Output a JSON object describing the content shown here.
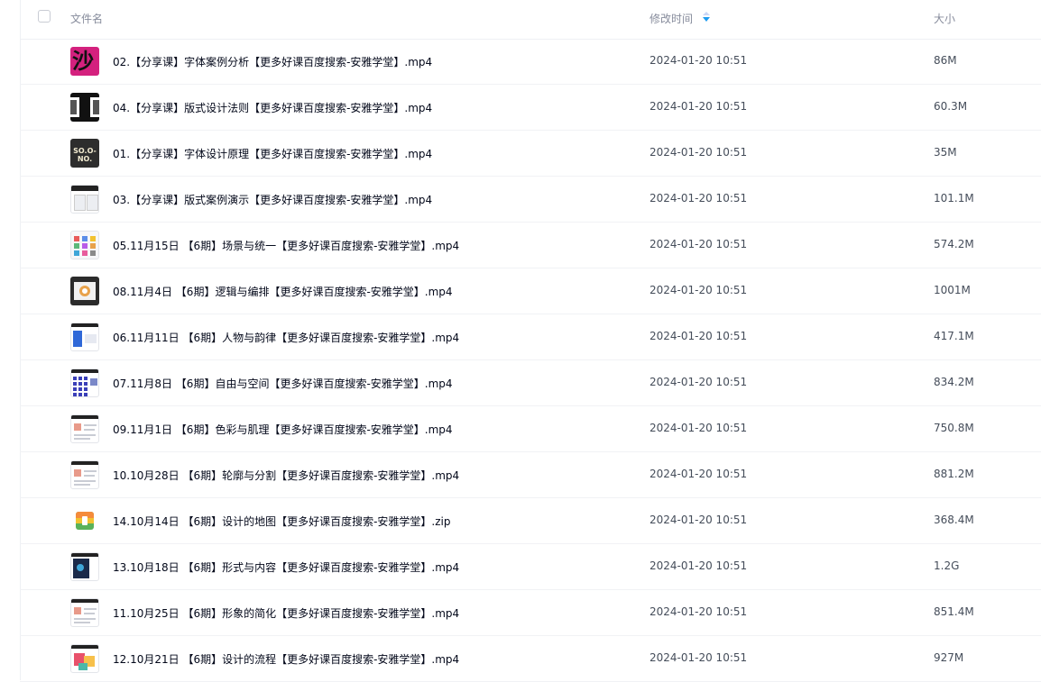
{
  "header": {
    "name_label": "文件名",
    "time_label": "修改时间",
    "size_label": "大小",
    "sort_icon": "sort-icon"
  },
  "files": [
    {
      "name": "02.【分享课】字体案例分析【更多好课百度搜索-安雅学堂】.mp4",
      "time": "2024-01-20 10:51",
      "size": "86M",
      "thumb": "pink",
      "thumb_text": "沙"
    },
    {
      "name": "04.【分享课】版式设计法则【更多好课百度搜索-安雅学堂】.mp4",
      "time": "2024-01-20 10:51",
      "size": "60.3M",
      "thumb": "bw"
    },
    {
      "name": "01.【分享课】字体设计原理【更多好课百度搜索-安雅学堂】.mp4",
      "time": "2024-01-20 10:51",
      "size": "35M",
      "thumb": "dark",
      "thumb_text": "SO.O-NO."
    },
    {
      "name": "03.【分享课】版式案例演示【更多好课百度搜索-安雅学堂】.mp4",
      "time": "2024-01-20 10:51",
      "size": "101.1M",
      "thumb": "doc"
    },
    {
      "name": "05.11月15日 【6期】场景与统一【更多好课百度搜索-安雅学堂】.mp4",
      "time": "2024-01-20 10:51",
      "size": "574.2M",
      "thumb": "grid"
    },
    {
      "name": "08.11月4日 【6期】逻辑与编排【更多好课百度搜索-安雅学堂】.mp4",
      "time": "2024-01-20 10:51",
      "size": "1001M",
      "thumb": "frame"
    },
    {
      "name": "06.11月11日 【6期】人物与韵律【更多好课百度搜索-安雅学堂】.mp4",
      "time": "2024-01-20 10:51",
      "size": "417.1M",
      "thumb": "blue"
    },
    {
      "name": "07.11月8日 【6期】自由与空间【更多好课百度搜索-安雅学堂】.mp4",
      "time": "2024-01-20 10:51",
      "size": "834.2M",
      "thumb": "tiles"
    },
    {
      "name": "09.11月1日 【6期】色彩与肌理【更多好课百度搜索-安雅学堂】.mp4",
      "time": "2024-01-20 10:51",
      "size": "750.8M",
      "thumb": "light"
    },
    {
      "name": "10.10月28日 【6期】轮廓与分割【更多好课百度搜索-安雅学堂】.mp4",
      "time": "2024-01-20 10:51",
      "size": "881.2M",
      "thumb": "light"
    },
    {
      "name": "14.10月14日 【6期】设计的地图【更多好课百度搜索-安雅学堂】.zip",
      "time": "2024-01-20 10:51",
      "size": "368.4M",
      "thumb": "zip"
    },
    {
      "name": "13.10月18日 【6期】形式与内容【更多好课百度搜索-安雅学堂】.mp4",
      "time": "2024-01-20 10:51",
      "size": "1.2G",
      "thumb": "navy"
    },
    {
      "name": "11.10月25日 【6期】形象的简化【更多好课百度搜索-安雅学堂】.mp4",
      "time": "2024-01-20 10:51",
      "size": "851.4M",
      "thumb": "light"
    },
    {
      "name": "12.10月21日 【6期】设计的流程【更多好课百度搜索-安雅学堂】.mp4",
      "time": "2024-01-20 10:51",
      "size": "927M",
      "thumb": "color"
    }
  ]
}
